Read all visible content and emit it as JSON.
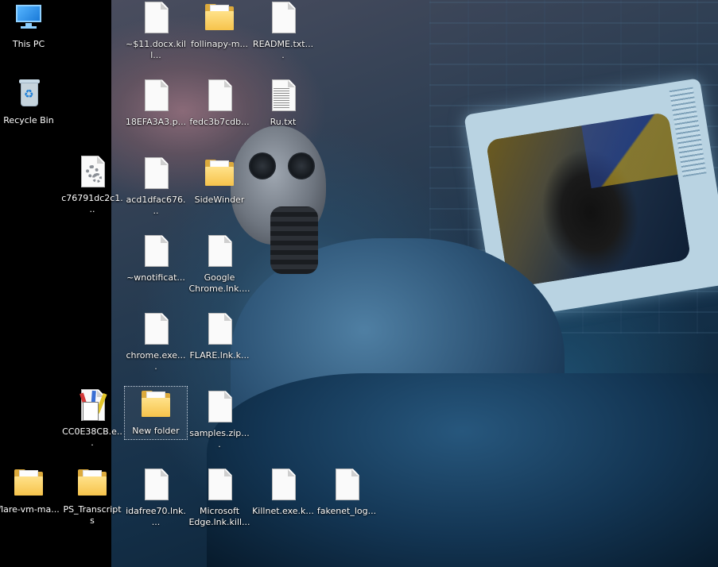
{
  "desktop": {
    "icons": [
      {
        "id": "this-pc",
        "label": "This PC",
        "type": "this-pc-icon"
      },
      {
        "id": "recycle-bin",
        "label": "Recycle Bin",
        "type": "recycle-bin-icon"
      },
      {
        "id": "c76791",
        "label": "c76791dc2c1...",
        "type": "settings-file-icon"
      },
      {
        "id": "cc0e38",
        "label": "CC0E38CB.e...",
        "type": "setup-exe-icon"
      },
      {
        "id": "flare-vm",
        "label": "flare-vm-ma...",
        "type": "folder-icon"
      },
      {
        "id": "ps-transcripts",
        "label": "PS_Transcripts",
        "type": "folder-icon"
      },
      {
        "id": "s1docx",
        "label": "~$11.docx.kill...",
        "type": "file-icon"
      },
      {
        "id": "18efa",
        "label": "18EFA3A3.p...",
        "type": "file-icon"
      },
      {
        "id": "acd1",
        "label": "acd1dfac676...",
        "type": "file-icon"
      },
      {
        "id": "wnotificat",
        "label": "~wnotificat...",
        "type": "file-icon"
      },
      {
        "id": "chrome-exe",
        "label": "chrome.exe....",
        "type": "file-icon"
      },
      {
        "id": "new-folder",
        "label": "New folder",
        "type": "folder-icon",
        "selected": true
      },
      {
        "id": "idafree",
        "label": "idafree70.lnk....",
        "type": "file-icon"
      },
      {
        "id": "follina",
        "label": "follinapy-m...",
        "type": "folder-icon"
      },
      {
        "id": "fedc3",
        "label": "fedc3b7cdb...",
        "type": "file-icon"
      },
      {
        "id": "sidewinder",
        "label": "SideWinder",
        "type": "folder-icon"
      },
      {
        "id": "google-chrome",
        "label": "Google Chrome.lnk....",
        "type": "file-icon"
      },
      {
        "id": "flare-lnk",
        "label": "FLARE.lnk.k...",
        "type": "file-icon"
      },
      {
        "id": "samples-zip",
        "label": "samples.zip....",
        "type": "file-icon"
      },
      {
        "id": "ms-edge",
        "label": "Microsoft Edge.lnk.kill...",
        "type": "file-icon"
      },
      {
        "id": "readme",
        "label": "README.txt....",
        "type": "text-file-icon"
      },
      {
        "id": "ru-txt",
        "label": "Ru.txt",
        "type": "text-file-icon"
      },
      {
        "id": "killnet",
        "label": "Killnet.exe.k...",
        "type": "file-icon"
      },
      {
        "id": "fakenet",
        "label": "fakenet_log...",
        "type": "file-icon"
      }
    ]
  }
}
